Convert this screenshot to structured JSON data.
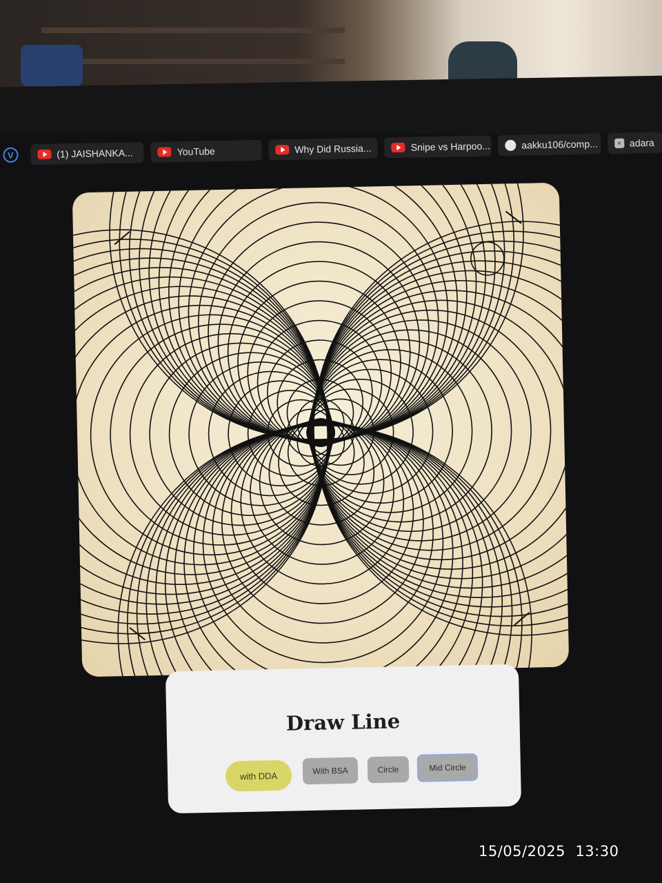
{
  "browser": {
    "tabs": [
      {
        "label": "(1) JAISHANKA...",
        "icon": "youtube-icon"
      },
      {
        "label": "YouTube",
        "icon": "youtube-icon"
      },
      {
        "label": "Why Did Russia...",
        "icon": "youtube-icon"
      },
      {
        "label": "Snipe vs Harpoo...",
        "icon": "youtube-icon"
      },
      {
        "label": "aakku106/comp...",
        "icon": "github-icon"
      },
      {
        "label": "adara",
        "icon": "close-box-icon"
      }
    ]
  },
  "controls": {
    "heading": "Draw Line",
    "buttons": {
      "dda": "with DDA",
      "bsa": "With BSA",
      "circle": "Circle",
      "mid_circle": "Mid Circle"
    }
  },
  "photo_timestamp": {
    "date": "15/05/2025",
    "time": "13:30"
  },
  "colors": {
    "canvas_bg": "#f2e7ca",
    "stroke": "#111111",
    "active_button": "#d8d667",
    "button": "#a9a9a9",
    "focus_ring": "#8fa9e0"
  }
}
